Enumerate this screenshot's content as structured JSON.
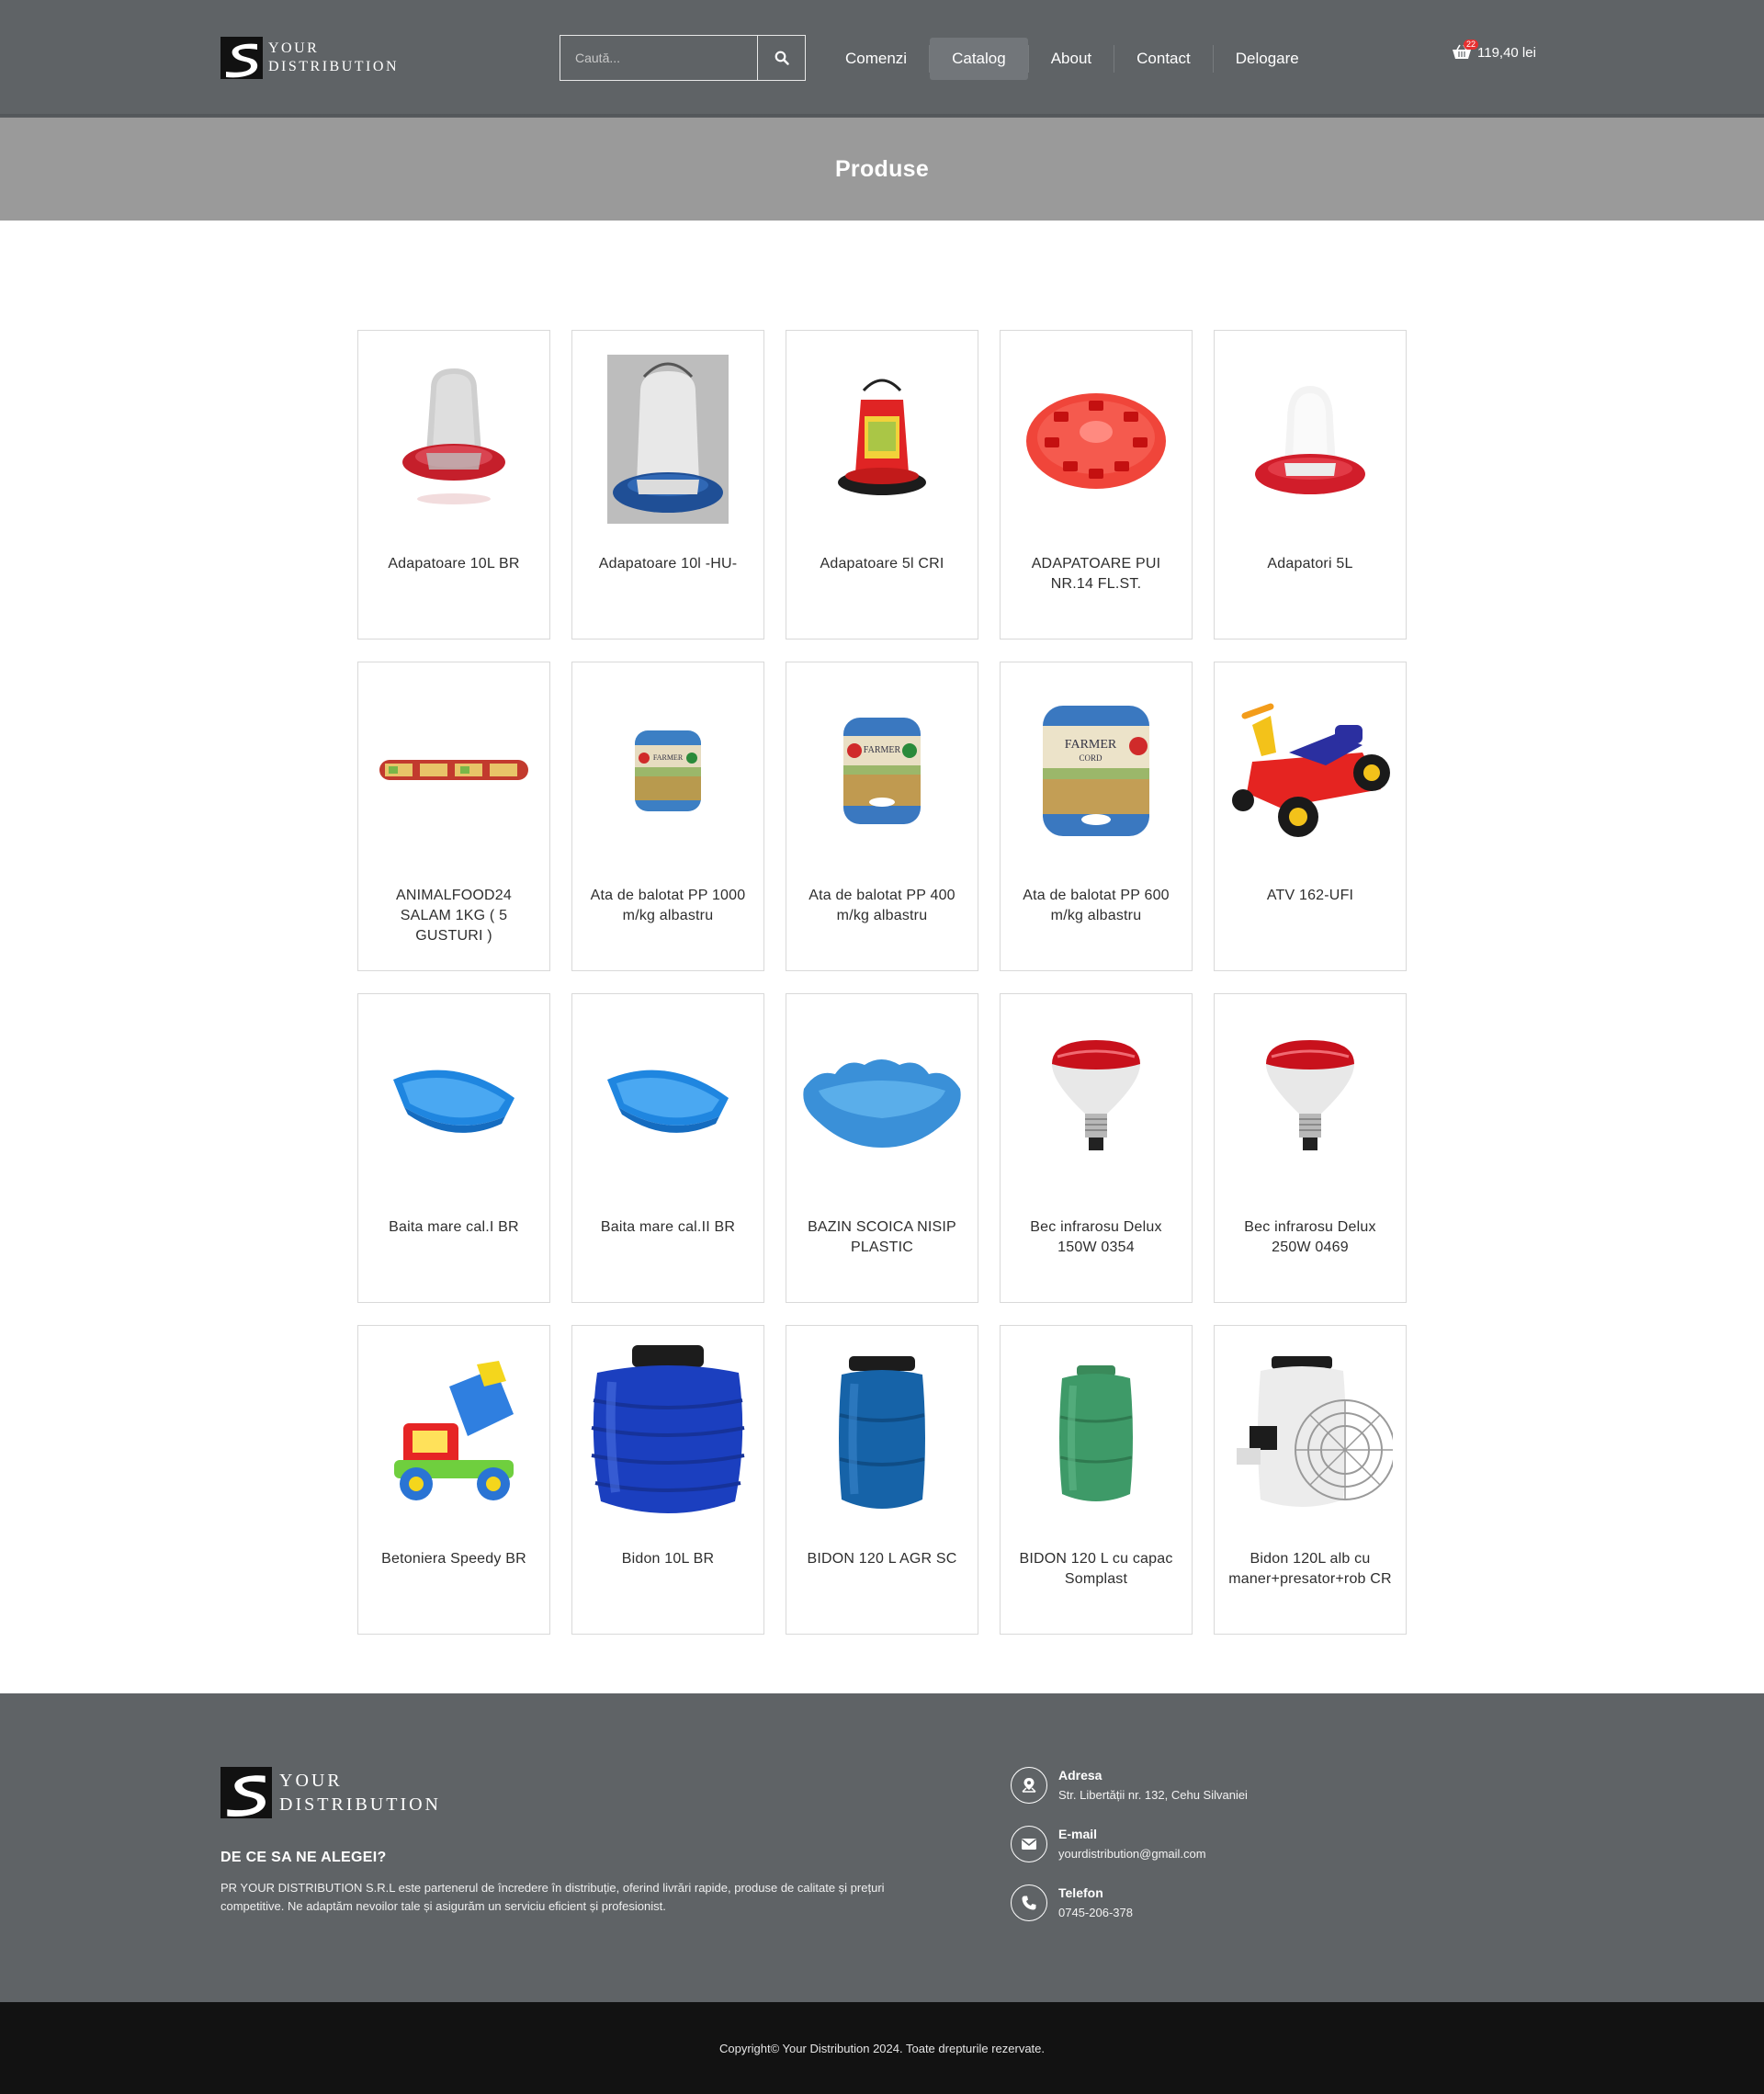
{
  "header": {
    "logo_line1": "YOUR",
    "logo_line2": "DISTRIBUTION",
    "search_placeholder": "Caută...",
    "nav": [
      "Comenzi",
      "Catalog",
      "About",
      "Contact",
      "Delogare"
    ],
    "active_nav": "Catalog",
    "cart_count": "22",
    "cart_total": "119,40 lei"
  },
  "page": {
    "title": "Produse"
  },
  "products": [
    {
      "name": "Adapatoare 10L BR",
      "image": "drinker-red-base"
    },
    {
      "name": "Adapatoare 10l -HU-",
      "image": "drinker-blue-base"
    },
    {
      "name": "Adapatoare 5l CRI",
      "image": "feeder-red"
    },
    {
      "name": "ADAPATOARE PUI NR.14 FL.ST.",
      "image": "chick-feeder-plate"
    },
    {
      "name": "Adapatori 5L",
      "image": "drinker-red-small"
    },
    {
      "name": "ANIMALFOOD24 SALAM 1KG ( 5 GUSTURI )",
      "image": "salami-sticks"
    },
    {
      "name": "Ata de balotat PP 1000 m/kg albastru",
      "image": "twine-roll-small"
    },
    {
      "name": "Ata de balotat PP 400 m/kg albastru",
      "image": "twine-roll-medium"
    },
    {
      "name": "Ata de balotat PP 600 m/kg albastru",
      "image": "twine-roll-large"
    },
    {
      "name": "ATV 162-UFI",
      "image": "toy-atv"
    },
    {
      "name": "Baita mare cal.I BR",
      "image": "plastic-tub-blue"
    },
    {
      "name": "Baita mare cal.II BR",
      "image": "plastic-tub-blue"
    },
    {
      "name": "BAZIN SCOICA NISIP PLASTIC",
      "image": "shell-sandpit"
    },
    {
      "name": "Bec infrarosu Delux 150W 0354",
      "image": "infrared-bulb"
    },
    {
      "name": "Bec infrarosu Delux 250W 0469",
      "image": "infrared-bulb"
    },
    {
      "name": "Betoniera Speedy BR",
      "image": "toy-mixer-truck"
    },
    {
      "name": "Bidon 10L BR",
      "image": "barrel-blue-wide"
    },
    {
      "name": "BIDON 120 L AGR SC",
      "image": "barrel-blue-tall"
    },
    {
      "name": "BIDON 120 L cu capac Somplast",
      "image": "barrel-green"
    },
    {
      "name": "Bidon 120L alb cu maner+presator+rob CR",
      "image": "barrel-white-press"
    }
  ],
  "footer": {
    "logo_line1": "YOUR",
    "logo_line2": "DISTRIBUTION",
    "why_title": "DE CE SA NE ALEGEI?",
    "why_text": "PR YOUR DISTRIBUTION S.R.L este partenerul de încredere în distribuție, oferind livrări rapide, produse de calitate și prețuri competitive. Ne adaptăm nevoilor tale și asigurăm un serviciu eficient și profesionist.",
    "contacts": [
      {
        "label": "Adresa",
        "value": "Str. Libertății nr. 132, Cehu Silvaniei",
        "icon": "map-icon"
      },
      {
        "label": "E-mail",
        "value": "yourdistribution@gmail.com",
        "icon": "envelope-icon"
      },
      {
        "label": "Telefon",
        "value": "0745-206-378",
        "icon": "phone-icon"
      }
    ],
    "copyright": "Copyright© Your Distribution 2024. Toate drepturile rezervate."
  }
}
